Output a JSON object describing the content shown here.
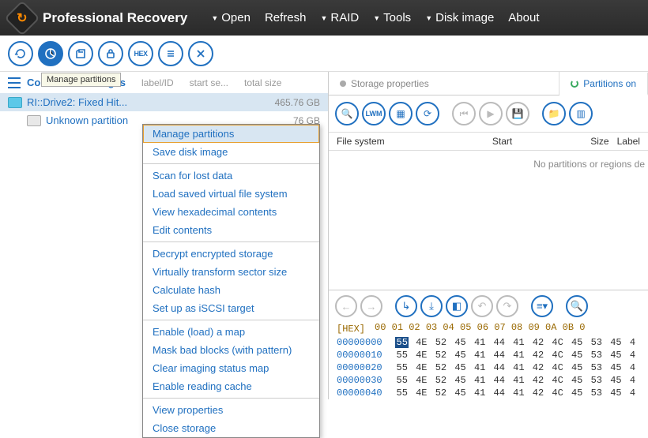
{
  "app": {
    "title": "Professional Recovery"
  },
  "menu": {
    "open": "Open",
    "refresh": "Refresh",
    "raid": "RAID",
    "tools": "Tools",
    "disk_image": "Disk image",
    "about": "About"
  },
  "tooltip": "Manage partitions",
  "left": {
    "title": "Connected storages",
    "cols": {
      "label": "label/ID",
      "start": "start se...",
      "size": "total size"
    },
    "drive": {
      "name": "RI::Drive2: Fixed Hit...",
      "label": "",
      "size": "465.76 GB"
    },
    "partition": {
      "name": "Unknown partition",
      "size": "76 GB"
    }
  },
  "ctx": {
    "items": [
      "Manage partitions",
      "Save disk image",
      "Scan for lost data",
      "Load saved virtual file system",
      "View hexadecimal contents",
      "Edit contents",
      "Decrypt encrypted storage",
      "Virtually transform sector size",
      "Calculate hash",
      "Set up as iSCSI target",
      "Enable (load) a map",
      "Mask bad blocks (with pattern)",
      "Clear imaging status map",
      "Enable reading cache",
      "View properties",
      "Close storage"
    ]
  },
  "right": {
    "tabs": {
      "props": "Storage properties",
      "parts": "Partitions on"
    },
    "ft": {
      "fs": "File system",
      "start": "Start",
      "size": "Size",
      "label": "Label"
    },
    "empty": "No partitions or regions de"
  },
  "hex": {
    "tag": "[HEX]",
    "cols": "00 01 02 03 04 05 06 07 08 09 0A 0B 0",
    "rows": [
      {
        "off": "00000000",
        "b": [
          "55",
          "4E",
          "52",
          "45",
          "41",
          "44",
          "41",
          "42",
          "4C",
          "45",
          "53",
          "45",
          "4"
        ],
        "hl": 0
      },
      {
        "off": "00000010",
        "b": [
          "55",
          "4E",
          "52",
          "45",
          "41",
          "44",
          "41",
          "42",
          "4C",
          "45",
          "53",
          "45",
          "4"
        ]
      },
      {
        "off": "00000020",
        "b": [
          "55",
          "4E",
          "52",
          "45",
          "41",
          "44",
          "41",
          "42",
          "4C",
          "45",
          "53",
          "45",
          "4"
        ]
      },
      {
        "off": "00000030",
        "b": [
          "55",
          "4E",
          "52",
          "45",
          "41",
          "44",
          "41",
          "42",
          "4C",
          "45",
          "53",
          "45",
          "4"
        ]
      },
      {
        "off": "00000040",
        "b": [
          "55",
          "4E",
          "52",
          "45",
          "41",
          "44",
          "41",
          "42",
          "4C",
          "45",
          "53",
          "45",
          "4"
        ]
      }
    ]
  }
}
